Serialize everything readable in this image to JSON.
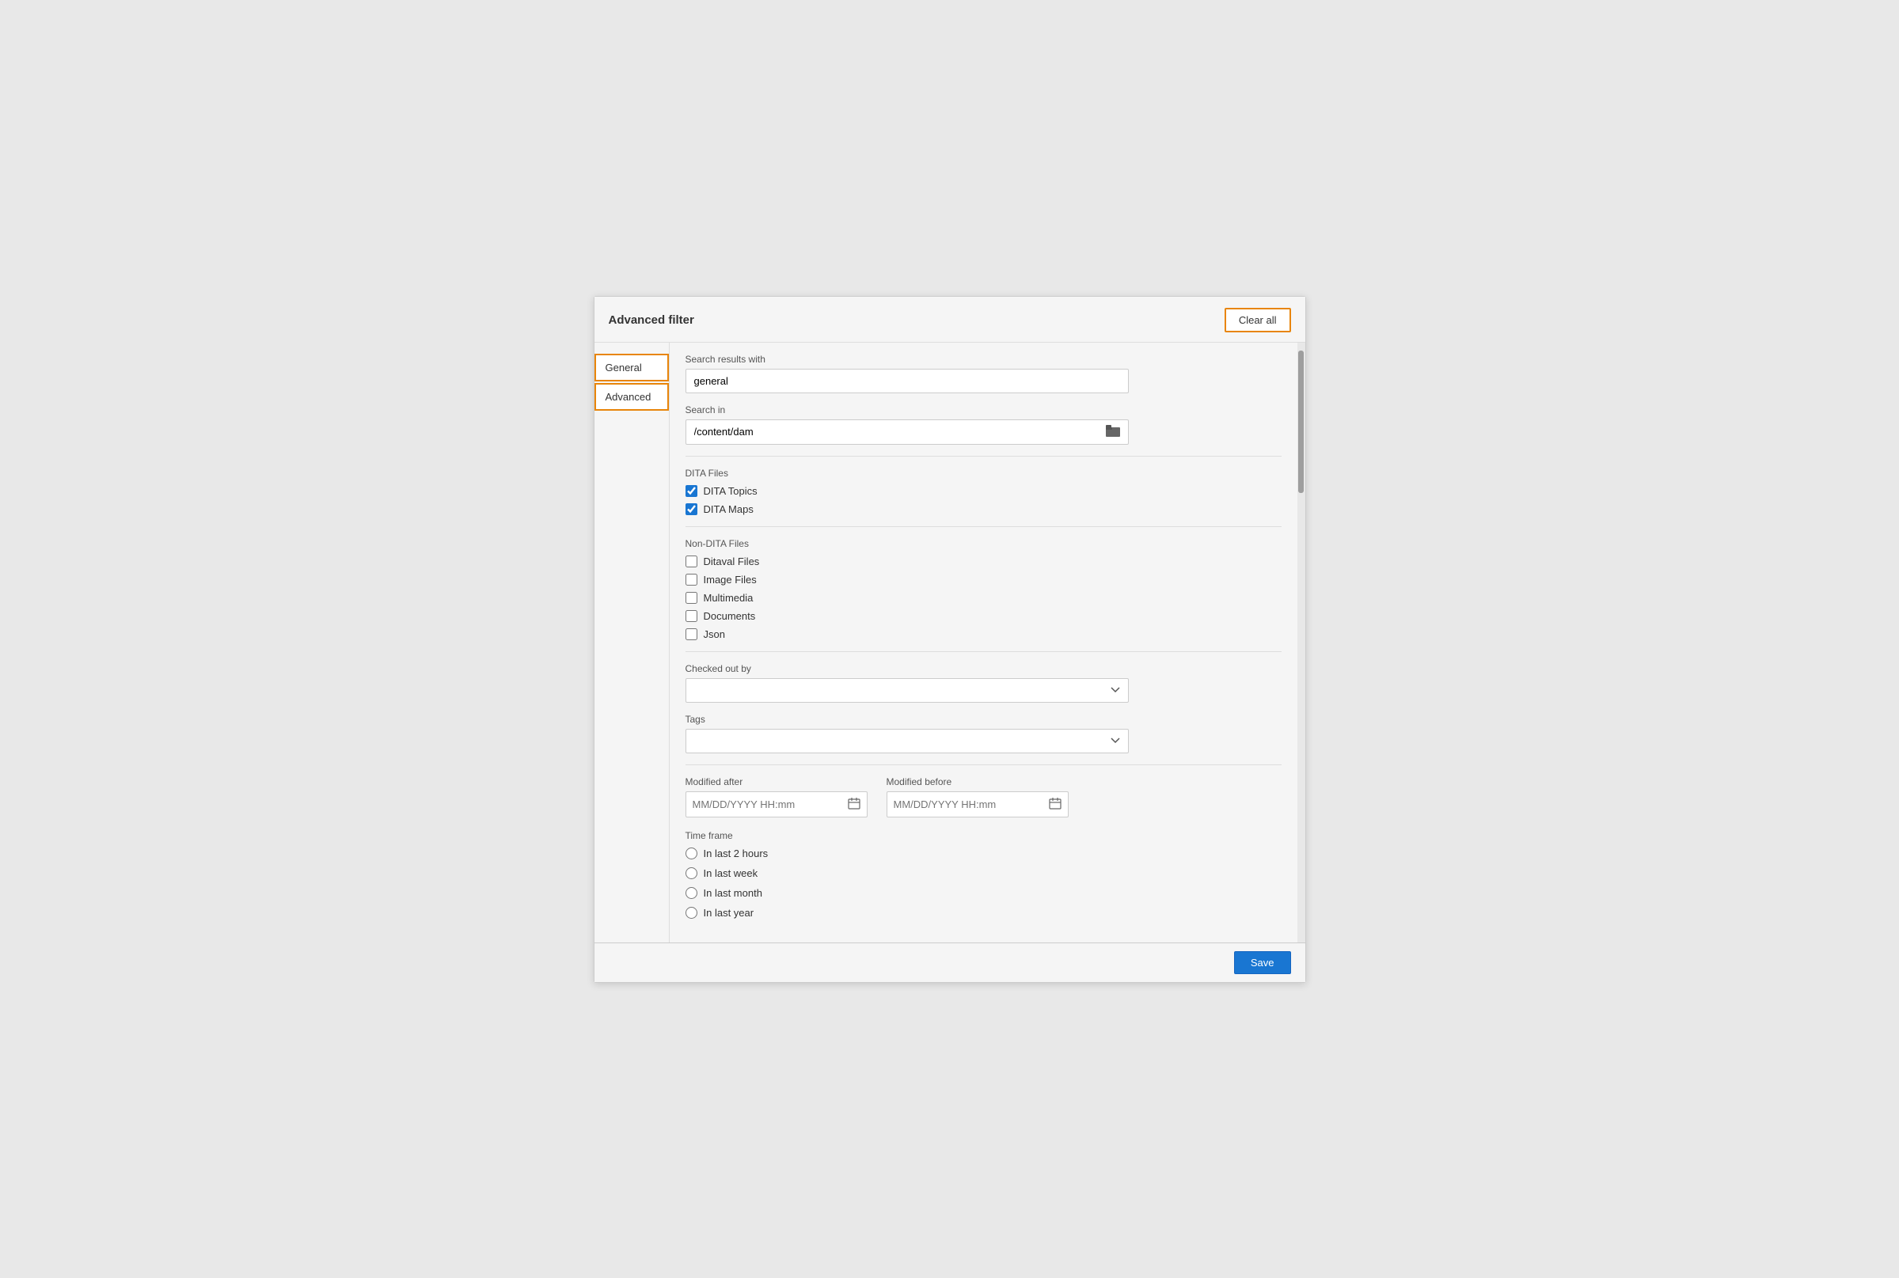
{
  "modal": {
    "title": "Advanced filter",
    "clear_all_label": "Clear all"
  },
  "sidebar": {
    "items": [
      {
        "id": "general",
        "label": "General",
        "active": true
      },
      {
        "id": "advanced",
        "label": "Advanced",
        "active": true
      }
    ]
  },
  "content": {
    "search_results_with_label": "Search results with",
    "search_results_with_value": "general",
    "search_in_label": "Search in",
    "search_in_value": "/content/dam",
    "dita_files_label": "DITA Files",
    "dita_topics_label": "DITA Topics",
    "dita_topics_checked": true,
    "dita_maps_label": "DITA Maps",
    "dita_maps_checked": true,
    "non_dita_files_label": "Non-DITA Files",
    "ditaval_files_label": "Ditaval Files",
    "ditaval_checked": false,
    "image_files_label": "Image Files",
    "image_files_checked": false,
    "multimedia_label": "Multimedia",
    "multimedia_checked": false,
    "documents_label": "Documents",
    "documents_checked": false,
    "json_label": "Json",
    "json_checked": false,
    "checked_out_by_label": "Checked out by",
    "tags_label": "Tags",
    "modified_after_label": "Modified after",
    "modified_after_placeholder": "MM/DD/YYYY HH:mm",
    "modified_before_label": "Modified before",
    "modified_before_placeholder": "MM/DD/YYYY HH:mm",
    "time_frame_label": "Time frame",
    "time_frame_options": [
      {
        "id": "2hours",
        "label": "In last 2 hours"
      },
      {
        "id": "week",
        "label": "In last week"
      },
      {
        "id": "month",
        "label": "In last month"
      },
      {
        "id": "year",
        "label": "In last year"
      }
    ]
  },
  "footer": {
    "save_label": "Save"
  }
}
